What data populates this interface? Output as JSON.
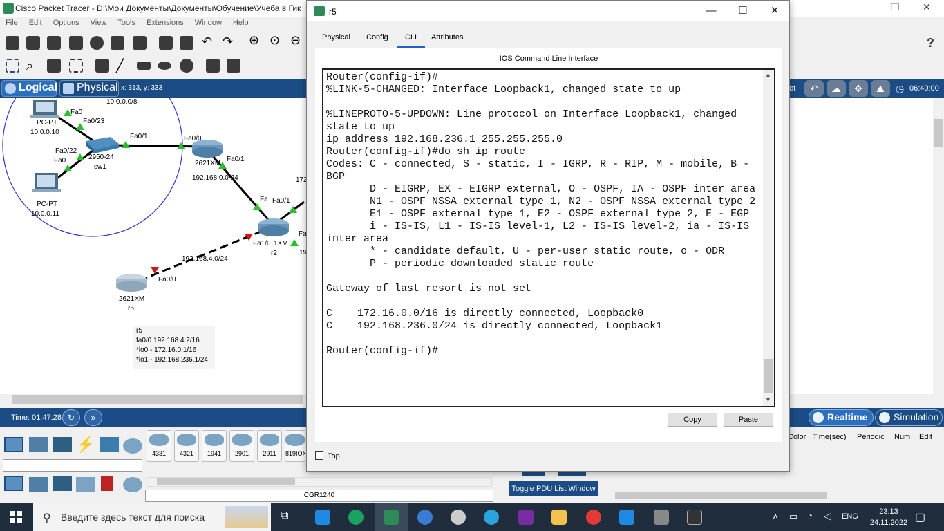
{
  "main_window": {
    "title": "Cisco Packet Tracer - D:\\Мои Документы\\Документы\\Обучение\\Учеба в Гик",
    "menu": [
      "File",
      "Edit",
      "Options",
      "View",
      "Tools",
      "Extensions",
      "Window",
      "Help"
    ],
    "logical_tab": "Logical",
    "physical_tab": "Physical",
    "coords": "x: 313, y: 333",
    "root_label": "oot",
    "clock_label": "06:40:00"
  },
  "workspace": {
    "labels": {
      "net_top": "10.0.0.0/8",
      "pc1_type": "PC-PT",
      "pc1_ip": "10.0.0.10",
      "pc2_type": "PC-PT",
      "pc2_ip": "10.0.0.11",
      "fa0_a": "Fa0",
      "fa0_23": "Fa0/23",
      "fa0_22": "Fa0/22",
      "fa0_b": "Fa0",
      "fa0_1_sw": "Fa0/1",
      "sw_model": "2950-24",
      "sw_name": "sw1",
      "fa0_0_r1": "Fa0/0",
      "r1_model": "2621XM",
      "fa0_1_r1": "Fa0/1",
      "net_r1_r2": "192.168.0.0/24",
      "fa_r2": "Fa",
      "fa0_1_r2": "Fa0/1",
      "fa_r2b": "Fa",
      "net_172": "172",
      "fa1_0": "Fa1/0",
      "r2_model": "1XM",
      "r2_name": "r2",
      "num_19": "19",
      "net_r2_r5": "192.168.4.0/24",
      "fa0_0_r5": "Fa0/0",
      "r5_model": "2621XM",
      "r5_name": "r5"
    },
    "note": {
      "line1": "r5",
      "line2": "fa0/0 192.168.4.2/16",
      "line3": "*lo0 - 172.16.0.1/16",
      "line4": "*lo1 - 192.168.236.1/24"
    }
  },
  "bottom_bar": {
    "time": "Time: 01:47:28",
    "realtime": "Realtime",
    "simulation": "Simulation"
  },
  "device_panel": {
    "tiles": [
      "4331",
      "4321",
      "1941",
      "2901",
      "2911",
      "819IOX"
    ],
    "selected_device": "CGR1240",
    "pdu_button": "Toggle PDU List Window",
    "pdu_columns": [
      "Color",
      "Time(sec)",
      "Periodic",
      "Num",
      "Edit"
    ]
  },
  "r5_dialog": {
    "title": "r5",
    "tabs": [
      "Physical",
      "Config",
      "CLI",
      "Attributes"
    ],
    "active_tab": "CLI",
    "header": "IOS Command Line Interface",
    "cli_output": "Router(config-if)#\n%LINK-5-CHANGED: Interface Loopback1, changed state to up\n\n%LINEPROTO-5-UPDOWN: Line protocol on Interface Loopback1, changed state to up\nip address 192.168.236.1 255.255.255.0\nRouter(config-if)#do sh ip route\nCodes: C - connected, S - static, I - IGRP, R - RIP, M - mobile, B - BGP\n       D - EIGRP, EX - EIGRP external, O - OSPF, IA - OSPF inter area\n       N1 - OSPF NSSA external type 1, N2 - OSPF NSSA external type 2\n       E1 - OSPF external type 1, E2 - OSPF external type 2, E - EGP\n       i - IS-IS, L1 - IS-IS level-1, L2 - IS-IS level-2, ia - IS-IS inter area\n       * - candidate default, U - per-user static route, o - ODR\n       P - periodic downloaded static route\n\nGateway of last resort is not set\n\nC    172.16.0.0/16 is directly connected, Loopback0\nC    192.168.236.0/24 is directly connected, Loopback1\n\nRouter(config-if)#",
    "copy_label": "Copy",
    "paste_label": "Paste",
    "top_label": "Top"
  },
  "taskbar": {
    "search_placeholder": "Введите здесь текст для поиска",
    "lang": "ENG",
    "time": "23:13",
    "date": "24.11.2022"
  }
}
